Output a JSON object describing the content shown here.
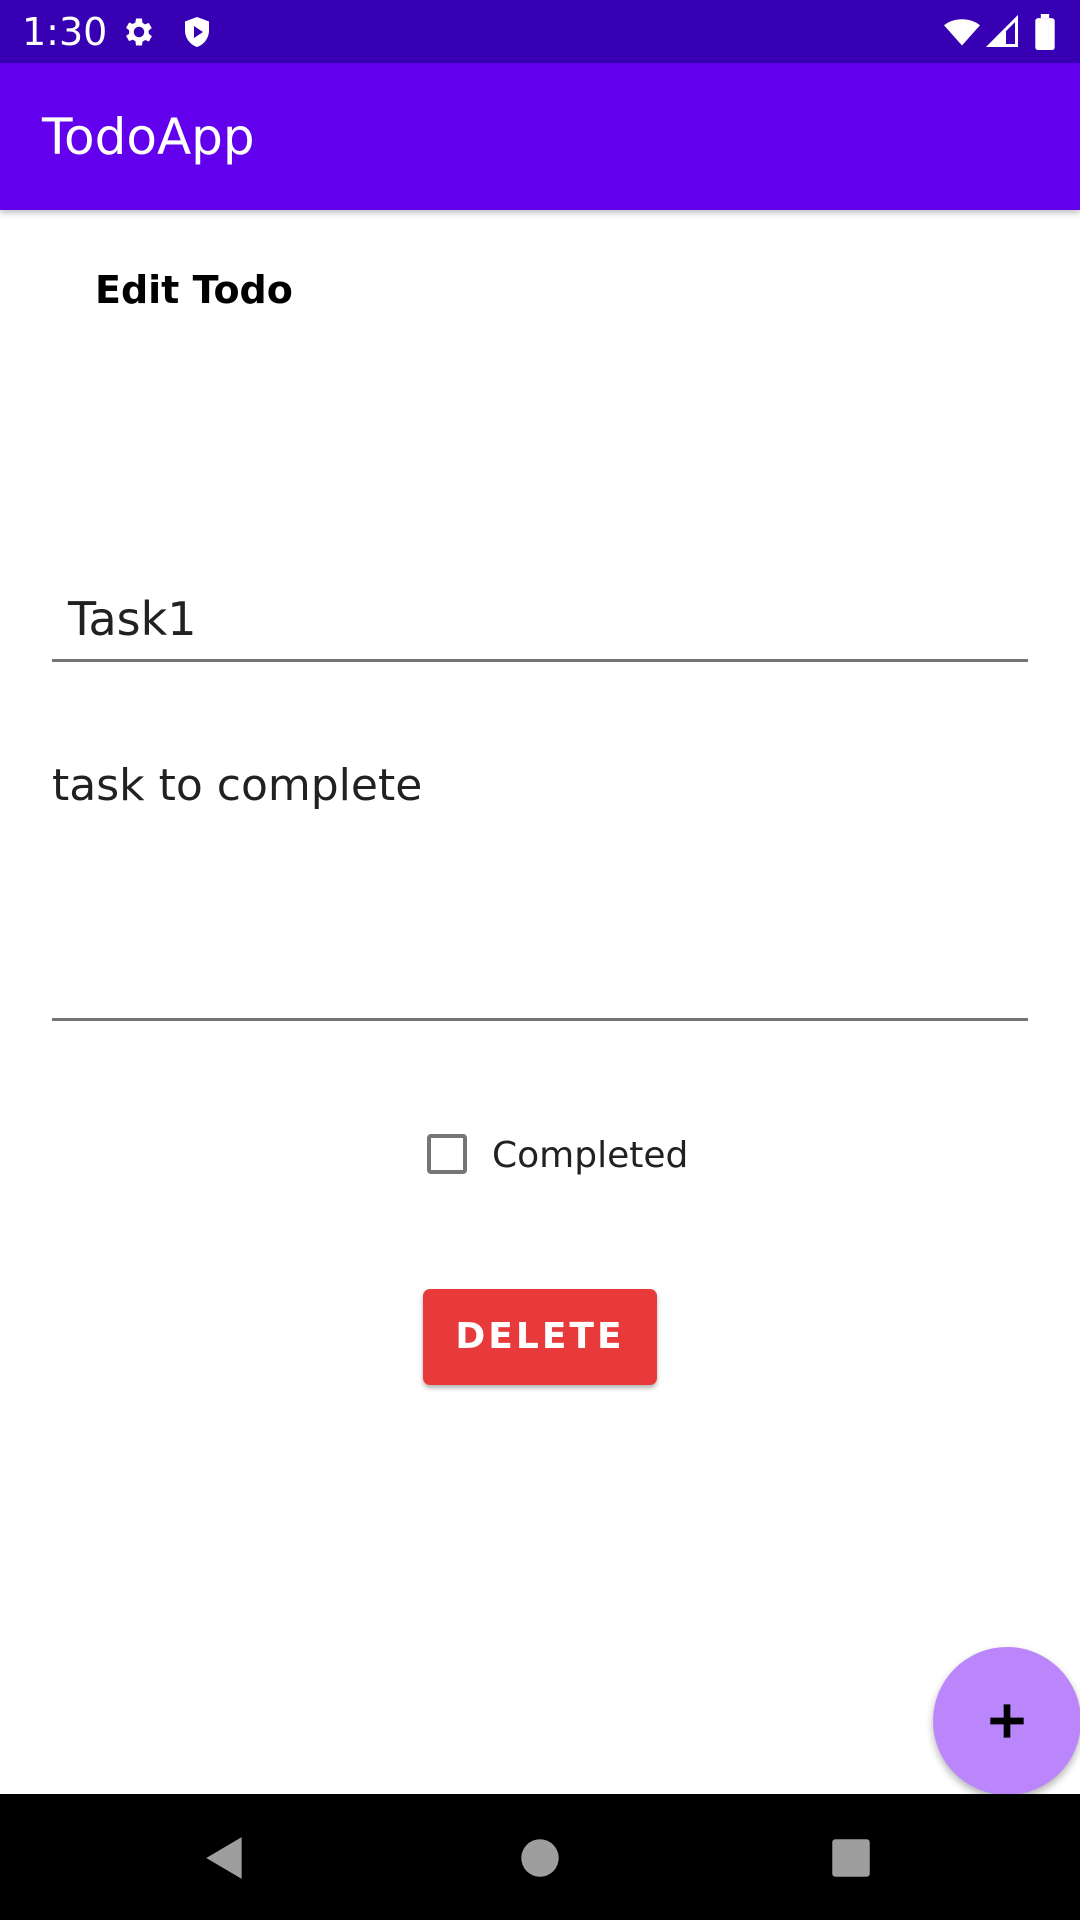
{
  "status_bar": {
    "time": "1:30",
    "icons": [
      "settings-icon",
      "shield-icon",
      "wifi-icon",
      "signal-icon",
      "battery-icon"
    ],
    "background": "#3700b3"
  },
  "app_bar": {
    "title": "TodoApp",
    "background": "#6200ee"
  },
  "content": {
    "section_title": "Edit Todo",
    "title_field": {
      "value": "Task1"
    },
    "description_field": {
      "value": "task to complete"
    },
    "completed_checkbox": {
      "label": "Completed",
      "checked": false
    },
    "delete_button": {
      "label": "DELETE",
      "color": "#e83a3a"
    }
  },
  "fab": {
    "icon": "plus-icon",
    "color": "#bb86fc"
  },
  "nav_bar": {
    "buttons": [
      "back-icon",
      "home-icon",
      "recents-icon"
    ]
  }
}
